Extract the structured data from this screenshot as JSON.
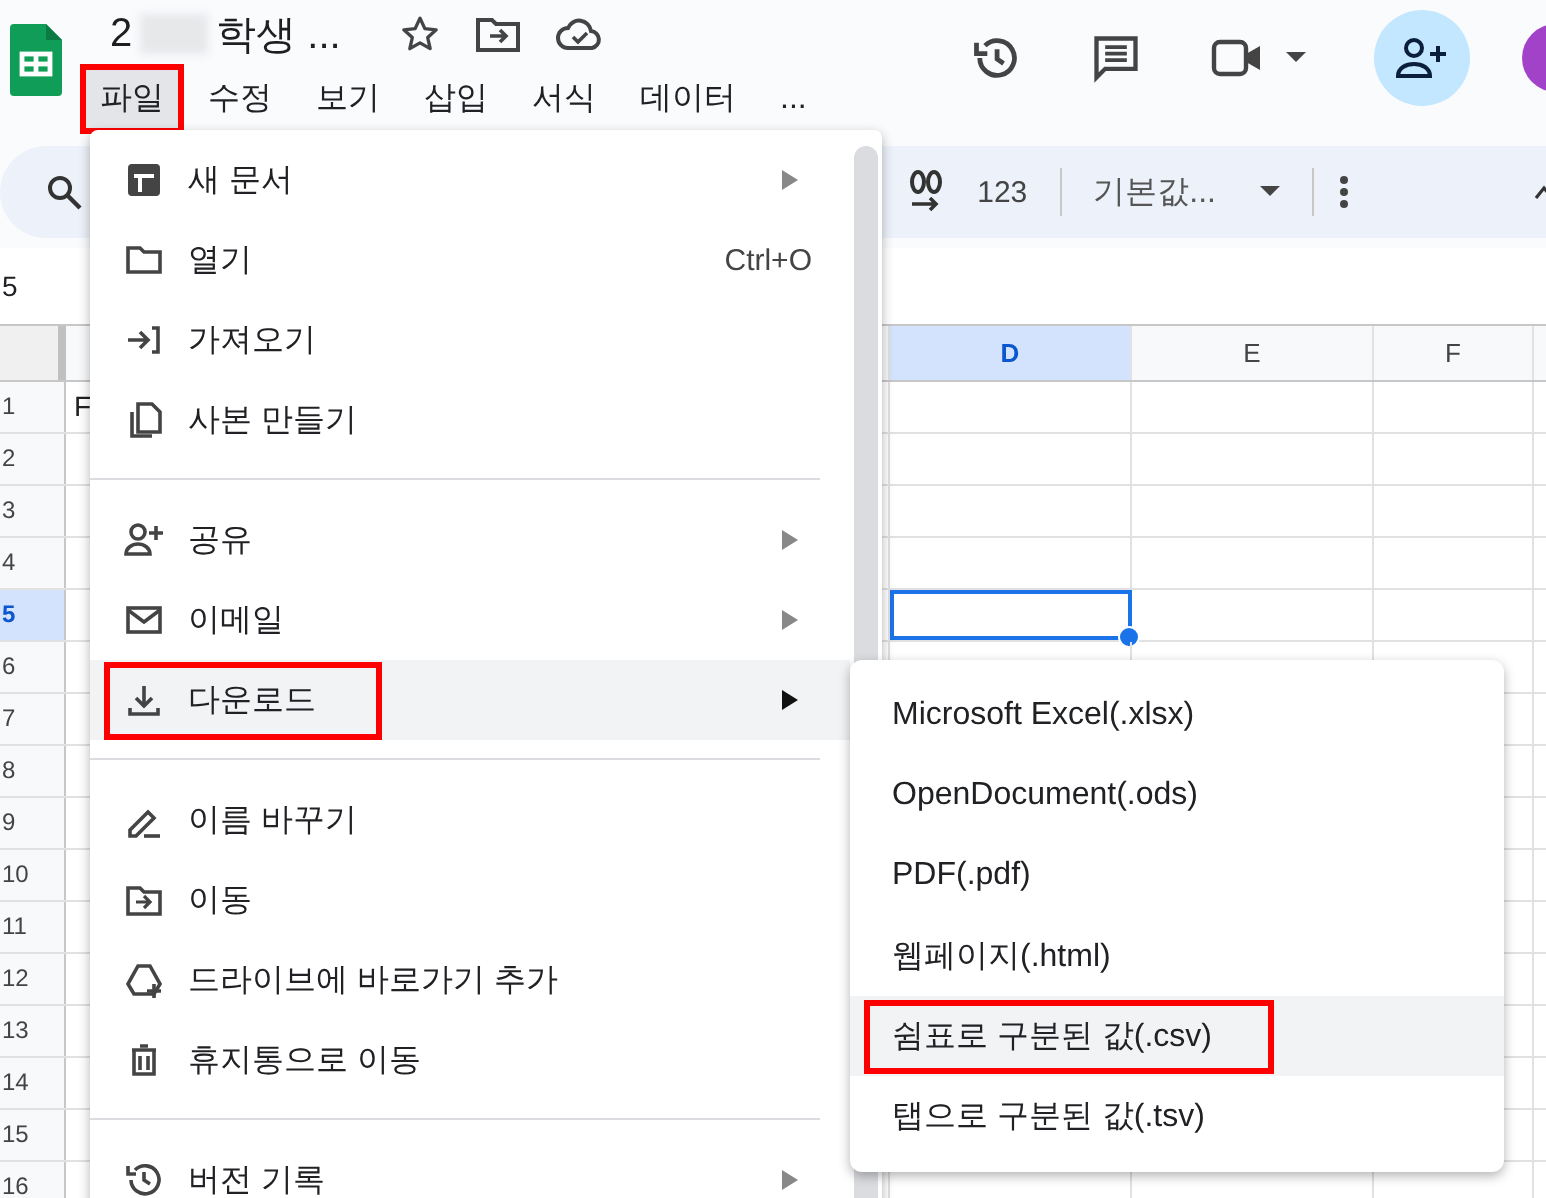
{
  "header": {
    "title_start": "2",
    "title_end": "학생 ...",
    "menu_bar": [
      {
        "label": "파일",
        "selected": true,
        "annotated": true
      },
      {
        "label": "수정",
        "selected": false,
        "annotated": false
      },
      {
        "label": "보기",
        "selected": false,
        "annotated": false
      },
      {
        "label": "삽입",
        "selected": false,
        "annotated": false
      },
      {
        "label": "서식",
        "selected": false,
        "annotated": false
      },
      {
        "label": "데이터",
        "selected": false,
        "annotated": false
      },
      {
        "label": "...",
        "selected": false,
        "annotated": false
      }
    ]
  },
  "toolbar": {
    "number_format": "123",
    "font": "기본값..."
  },
  "name_box": "5",
  "grid": {
    "columns": [
      {
        "label": "D",
        "selected": true
      },
      {
        "label": "E",
        "selected": false
      },
      {
        "label": "F",
        "selected": false
      }
    ],
    "rows": [
      {
        "number": "1",
        "selected": false,
        "cell_text": "F"
      },
      {
        "number": "2",
        "selected": false
      },
      {
        "number": "3",
        "selected": false
      },
      {
        "number": "4",
        "selected": false
      },
      {
        "number": "5",
        "selected": true
      },
      {
        "number": "6",
        "selected": false
      },
      {
        "number": "7",
        "selected": false
      },
      {
        "number": "8",
        "selected": false
      },
      {
        "number": "9",
        "selected": false
      },
      {
        "number": "10",
        "selected": false
      },
      {
        "number": "11",
        "selected": false
      },
      {
        "number": "12",
        "selected": false
      },
      {
        "number": "13",
        "selected": false
      },
      {
        "number": "14",
        "selected": false
      },
      {
        "number": "15",
        "selected": false
      },
      {
        "number": "16",
        "selected": false
      }
    ]
  },
  "file_menu": [
    {
      "kind": "item",
      "label": "새 문서",
      "submenu": true,
      "highlighted": false,
      "annotated": false
    },
    {
      "kind": "item",
      "label": "열기",
      "shortcut": "Ctrl+O",
      "submenu": false,
      "highlighted": false,
      "annotated": false
    },
    {
      "kind": "item",
      "label": "가져오기",
      "submenu": false,
      "highlighted": false,
      "annotated": false
    },
    {
      "kind": "item",
      "label": "사본 만들기",
      "submenu": false,
      "highlighted": false,
      "annotated": false
    },
    {
      "kind": "divider"
    },
    {
      "kind": "item",
      "label": "공유",
      "submenu": true,
      "highlighted": false,
      "annotated": false
    },
    {
      "kind": "item",
      "label": "이메일",
      "submenu": true,
      "highlighted": false,
      "annotated": false
    },
    {
      "kind": "item",
      "label": "다운로드",
      "submenu": true,
      "highlighted": true,
      "annotated": true
    },
    {
      "kind": "divider"
    },
    {
      "kind": "item",
      "label": "이름 바꾸기",
      "submenu": false,
      "highlighted": false,
      "annotated": false
    },
    {
      "kind": "item",
      "label": "이동",
      "submenu": false,
      "highlighted": false,
      "annotated": false
    },
    {
      "kind": "item",
      "label": "드라이브에 바로가기 추가",
      "submenu": false,
      "highlighted": false,
      "annotated": false
    },
    {
      "kind": "item",
      "label": "휴지통으로 이동",
      "submenu": false,
      "highlighted": false,
      "annotated": false
    },
    {
      "kind": "divider"
    },
    {
      "kind": "item",
      "label": "버전 기록",
      "submenu": true,
      "highlighted": false,
      "annotated": false
    }
  ],
  "download_menu": [
    {
      "label": "Microsoft Excel(.xlsx)",
      "highlighted": false,
      "annotated": false
    },
    {
      "label": "OpenDocument(.ods)",
      "highlighted": false,
      "annotated": false
    },
    {
      "label": "PDF(.pdf)",
      "highlighted": false,
      "annotated": false
    },
    {
      "label": "웹페이지(.html)",
      "highlighted": false,
      "annotated": false
    },
    {
      "label": "쉼표로 구분된 값(.csv)",
      "highlighted": true,
      "annotated": true
    },
    {
      "label": "탭으로 구분된 값(.tsv)",
      "highlighted": false,
      "annotated": false
    }
  ]
}
